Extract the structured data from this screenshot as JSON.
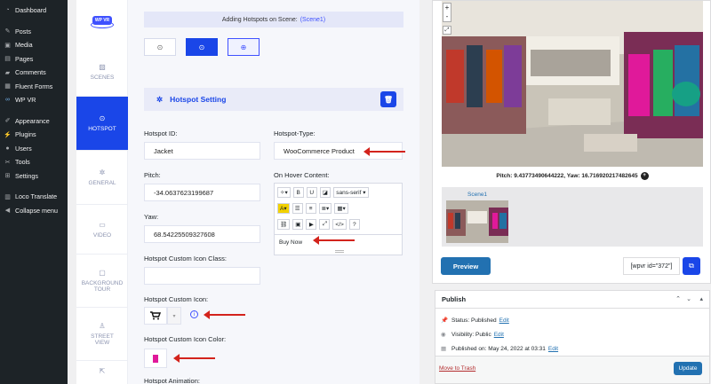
{
  "wp_menu": [
    {
      "label": "Dashboard",
      "icon": "dashboard-icon"
    },
    {
      "label": "Posts",
      "icon": "pin-icon"
    },
    {
      "label": "Media",
      "icon": "media-icon"
    },
    {
      "label": "Pages",
      "icon": "page-icon"
    },
    {
      "label": "Comments",
      "icon": "comment-icon"
    },
    {
      "label": "Fluent Forms",
      "icon": "form-icon"
    },
    {
      "label": "WP VR",
      "icon": "vr-icon"
    },
    {
      "label": "Appearance",
      "icon": "brush-icon"
    },
    {
      "label": "Plugins",
      "icon": "plug-icon"
    },
    {
      "label": "Users",
      "icon": "user-icon"
    },
    {
      "label": "Tools",
      "icon": "wrench-icon"
    },
    {
      "label": "Settings",
      "icon": "settings-icon"
    },
    {
      "label": "Loco Translate",
      "icon": "translate-icon"
    },
    {
      "label": "Collapse menu",
      "icon": "collapse-icon"
    }
  ],
  "logo_text": "WP VR",
  "tabs": [
    {
      "label": "SCENES"
    },
    {
      "label": "HOTSPOT"
    },
    {
      "label": "GENERAL"
    },
    {
      "label": "VIDEO"
    },
    {
      "label": "BACKGROUND TOUR"
    },
    {
      "label": "STREET VIEW"
    }
  ],
  "banner": {
    "text": "Adding Hotspots on Scene:",
    "scene": "(Scene1)"
  },
  "hotspot_setting": "Hotspot Setting",
  "fields": {
    "hotspot_id_label": "Hotspot ID:",
    "hotspot_id_value": "Jacket",
    "hotspot_type_label": "Hotspot-Type:",
    "hotspot_type_value": "WooCommerce Product",
    "pitch_label": "Pitch:",
    "pitch_value": "-34.0637623199687",
    "on_hover_label": "On Hover Content:",
    "yaw_label": "Yaw:",
    "yaw_value": "68.54225509327608",
    "custom_icon_class_label": "Hotspot Custom Icon Class:",
    "custom_icon_label": "Hotspot Custom Icon:",
    "custom_icon_color_label": "Hotspot Custom Icon Color:",
    "custom_icon_color": "#e0199a",
    "animation_label": "Hotspot Animation:"
  },
  "editor": {
    "font": "sans-serif",
    "content": "Buy Now",
    "toolbar_b": "B",
    "toolbar_u": "U",
    "toolbar_code": "</>",
    "toolbar_help": "?"
  },
  "pano": {
    "coords": "Pitch: 9.43773490644222, Yaw: 16.716920217482645",
    "scene_title": "Scene1",
    "zoom_in": "+",
    "zoom_out": "-"
  },
  "preview_label": "Preview",
  "shortcode": "[wpvr id=\"372\"]",
  "publish": {
    "title": "Publish",
    "status_label": "Status:",
    "status_value": "Published",
    "visibility_label": "Visibility:",
    "visibility_value": "Public",
    "published_on": "Published on: May 24, 2022 at 03:31",
    "edit": "Edit",
    "trash": "Move to Trash",
    "update": "Update"
  },
  "colors": {
    "accent": "#1a46e8",
    "wp_blue": "#2271b1",
    "arrow": "#d3231c"
  }
}
